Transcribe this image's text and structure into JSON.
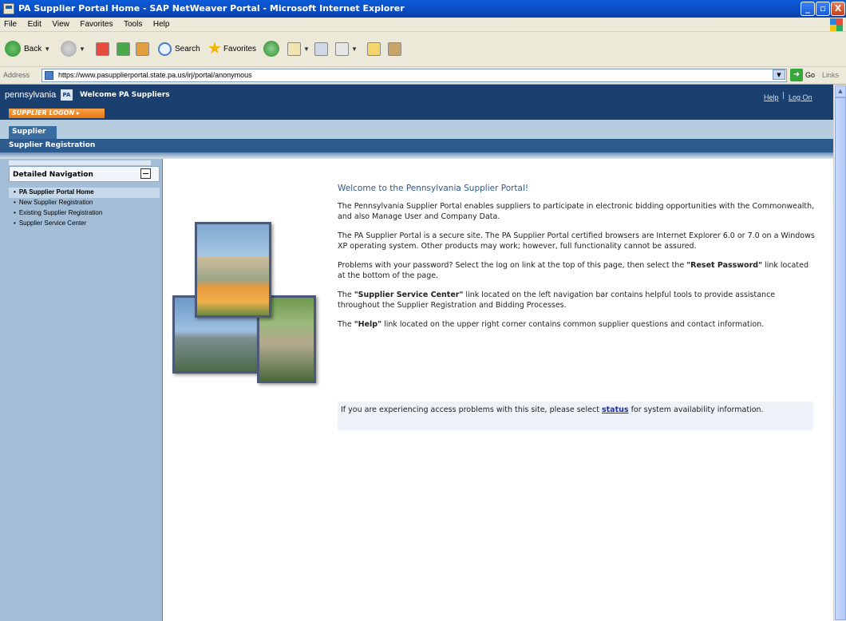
{
  "window": {
    "title": "PA Supplier Portal Home - SAP NetWeaver Portal - Microsoft Internet Explorer",
    "min_label": "_",
    "max_label": "▫",
    "close_label": "X"
  },
  "menu": [
    "File",
    "Edit",
    "View",
    "Favorites",
    "Tools",
    "Help"
  ],
  "toolbar": {
    "back_label": "Back",
    "search_label": "Search",
    "favorites_label": "Favorites"
  },
  "address": {
    "label": "Address",
    "url": "https://www.pasupplierportal.state.pa.us/irj/portal/anonymous",
    "go_label": "Go",
    "links_label": "Links"
  },
  "portal": {
    "logo_text": "pennsylvania",
    "welcome": "Welcome PA Suppliers",
    "help": "Help",
    "separator": "|",
    "logon": "Log On",
    "supplier_logon_button": "SUPPLIER LOGON ▸",
    "tab": "Supplier",
    "subnav_item": "Supplier Registration"
  },
  "leftnav": {
    "title": "Detailed Navigation",
    "items": [
      {
        "label": "PA Supplier Portal Home",
        "active": true
      },
      {
        "label": "New Supplier Registration",
        "active": false
      },
      {
        "label": "Existing Supplier Registration",
        "active": false
      },
      {
        "label": "Supplier Service Center",
        "active": false
      }
    ]
  },
  "content": {
    "heading": "Welcome to the Pennsylvania Supplier Portal!",
    "p1": "The Pennsylvania Supplier Portal enables suppliers to participate in electronic bidding opportunities with the Commonwealth, and also Manage User and Company Data.",
    "p2": "The PA Supplier Portal is a secure site. The PA Supplier Portal certified browsers are Internet Explorer 6.0 or 7.0 on a Windows XP operating system. Other products may work; however, full functionality cannot be assured.",
    "p3_pre": "Problems with your password?  Select the log on link at the top of this page, then select the ",
    "p3_bold": "\"Reset Password\"",
    "p3_post": " link located at the bottom of the page.",
    "p4_pre": "The ",
    "p4_bold": "\"Supplier Service Center\"",
    "p4_post": " link located on the left navigation bar contains helpful tools to provide assistance throughout the Supplier Registration and Bidding Processes.",
    "p5_pre": "The ",
    "p5_bold": "\"Help\"",
    "p5_post": " link located on the upper right corner contains common supplier questions and contact information.",
    "notice_pre": "If you are experiencing access problems with this site, please select ",
    "notice_link": "status",
    "notice_post": " for system availability information."
  },
  "colors": {
    "portal_header": "#1b3f6e",
    "logon_button": "#e8760e",
    "nav_background": "#a4bed8",
    "heading": "#2e5b8d"
  }
}
